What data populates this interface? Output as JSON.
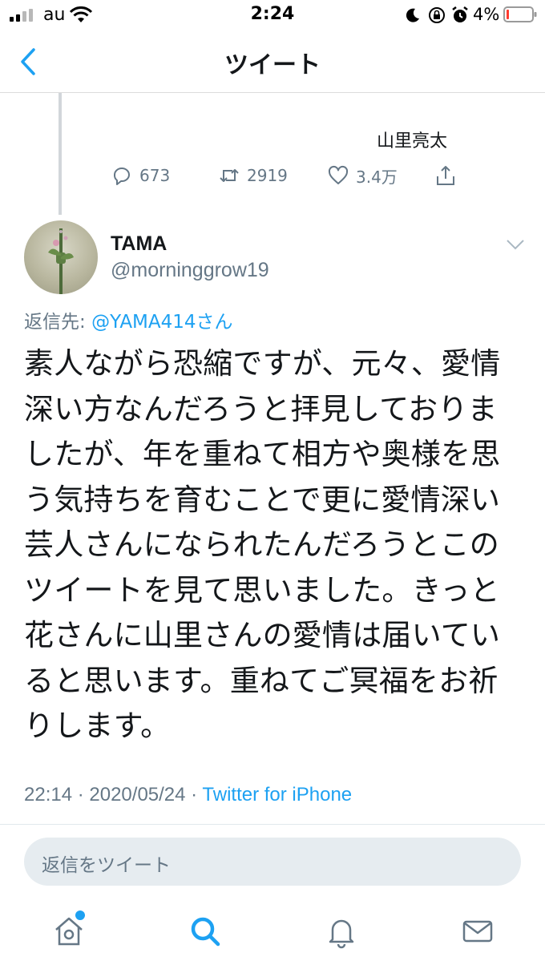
{
  "status_bar": {
    "carrier": "au",
    "time": "2:24",
    "battery": "4%"
  },
  "nav": {
    "title": "ツイート",
    "back_icon": "chevron-left-icon"
  },
  "previous_tweet": {
    "author": "山里亮太",
    "reply_count": "673",
    "retweet_count": "2919",
    "like_count": "3.4万"
  },
  "tweet": {
    "display_name": "TAMA",
    "handle": "@morninggrow19",
    "reply_to_label": "返信先: ",
    "reply_to_mention": "@YAMA414さん",
    "text": "素人ながら恐縮ですが、元々、愛情深い方なんだろうと拝見しておりましたが、年を重ねて相方や奥様を思う気持ちを育むことで更に愛情深い芸人さんになられたんだろうとこのツイートを見て思いました。きっと花さんに山里さんの愛情は届いていると思います。重ねてご冥福をお祈りします。",
    "timestamp": "22:14 · 2020/05/24 · ",
    "source": "Twitter for iPhone"
  },
  "reply_box": {
    "placeholder": "返信をツイート"
  },
  "tabs": [
    "home-icon",
    "search-icon",
    "notifications-icon",
    "messages-icon"
  ],
  "colors": {
    "accent": "#1da1f2",
    "secondary_text": "#657786"
  }
}
